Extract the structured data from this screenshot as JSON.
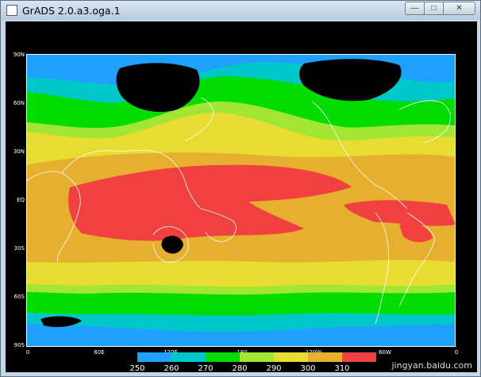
{
  "window": {
    "title": "GrADS 2.0.a3.oga.1",
    "buttons": {
      "minimize": "—",
      "maximize": "□",
      "close": "✕"
    }
  },
  "map": {
    "lat_labels": [
      "90N",
      "60N",
      "30N",
      "EQ",
      "30S",
      "60S",
      "90S"
    ],
    "lon_labels": [
      "0",
      "60E",
      "120E",
      "180",
      "120W",
      "60W",
      "0"
    ],
    "colorbar": {
      "colors": [
        "#1fa0ff",
        "#00c8c8",
        "#00dc00",
        "#a0e632",
        "#e6dc32",
        "#e6af2d",
        "#f04040"
      ],
      "labels": [
        "250",
        "260",
        "270",
        "280",
        "290",
        "300",
        "310"
      ]
    },
    "land_mask_color": "#000000",
    "coastline_color": "#ffffff"
  },
  "watermark": "jingyan.baidu.com"
}
